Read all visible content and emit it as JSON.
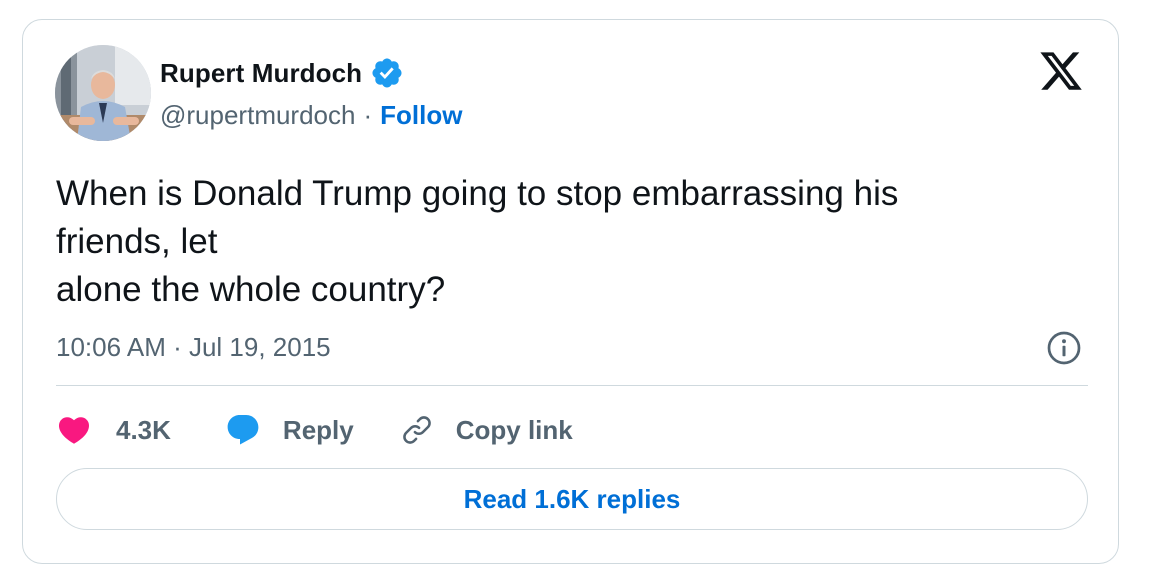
{
  "author": {
    "name": "Rupert Murdoch",
    "handle": "@rupertmurdoch",
    "separator": "·",
    "follow_label": "Follow",
    "avatar_icon": "profile-photo",
    "verified_icon": "verified-badge-icon"
  },
  "brand": {
    "logo_icon": "x-logo-icon"
  },
  "tweet": {
    "text_lines": [
      "When is Donald Trump going to stop embarrassing his",
      "friends, let",
      "alone the whole country?"
    ],
    "timestamp": "10:06 AM · Jul 19, 2015"
  },
  "actions": {
    "like_count": "4.3K",
    "reply_label": "Reply",
    "copy_link_label": "Copy link"
  },
  "footer": {
    "read_replies_label": "Read 1.6K replies"
  },
  "colors": {
    "accent": "#006fd6",
    "verified": "#1d9bf0",
    "like": "#f91880",
    "reply": "#1d9bf0",
    "text_primary": "#0f1419",
    "text_secondary": "#536471",
    "border": "#cfd9de"
  }
}
